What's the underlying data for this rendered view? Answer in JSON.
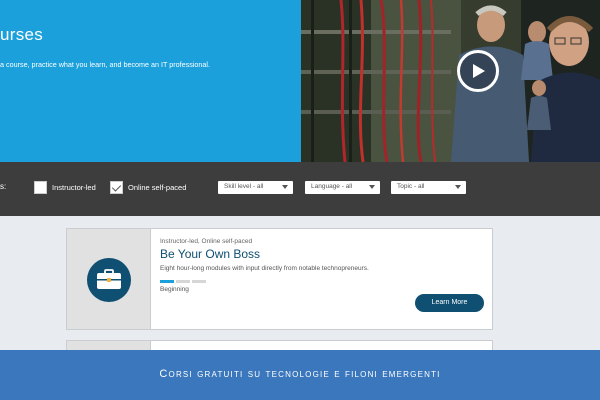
{
  "hero": {
    "title": "urses",
    "subtitle": "a course, practice what you learn, and become an IT professional.",
    "video": {
      "play_icon": "play-icon"
    }
  },
  "filters": {
    "colon": "s:",
    "checkboxes": [
      {
        "label": "Instructor-led",
        "checked": false
      },
      {
        "label": "Online self-paced",
        "checked": true
      }
    ],
    "selects": [
      {
        "value": "Skill level - all"
      },
      {
        "value": "Language - all"
      },
      {
        "value": "Topic - all"
      }
    ]
  },
  "course": {
    "meta": "Instructor-led, Online self-paced",
    "title": "Be Your Own Boss",
    "description": "Eight hour-long modules with input directly from notable technopreneurs.",
    "level_label": "Beginning",
    "level_segments_filled": 1,
    "level_segments_total": 3,
    "button_label": "Learn More",
    "icon": "briefcase-icon"
  },
  "banner": {
    "text": "Corsi gratuiti su tecnologie e filoni emergenti"
  },
  "colors": {
    "hero_blue": "#1ba0dc",
    "filter_bar": "#3d3d3d",
    "brand_dark_blue": "#0e4f72",
    "banner_blue": "#3a77bd"
  }
}
